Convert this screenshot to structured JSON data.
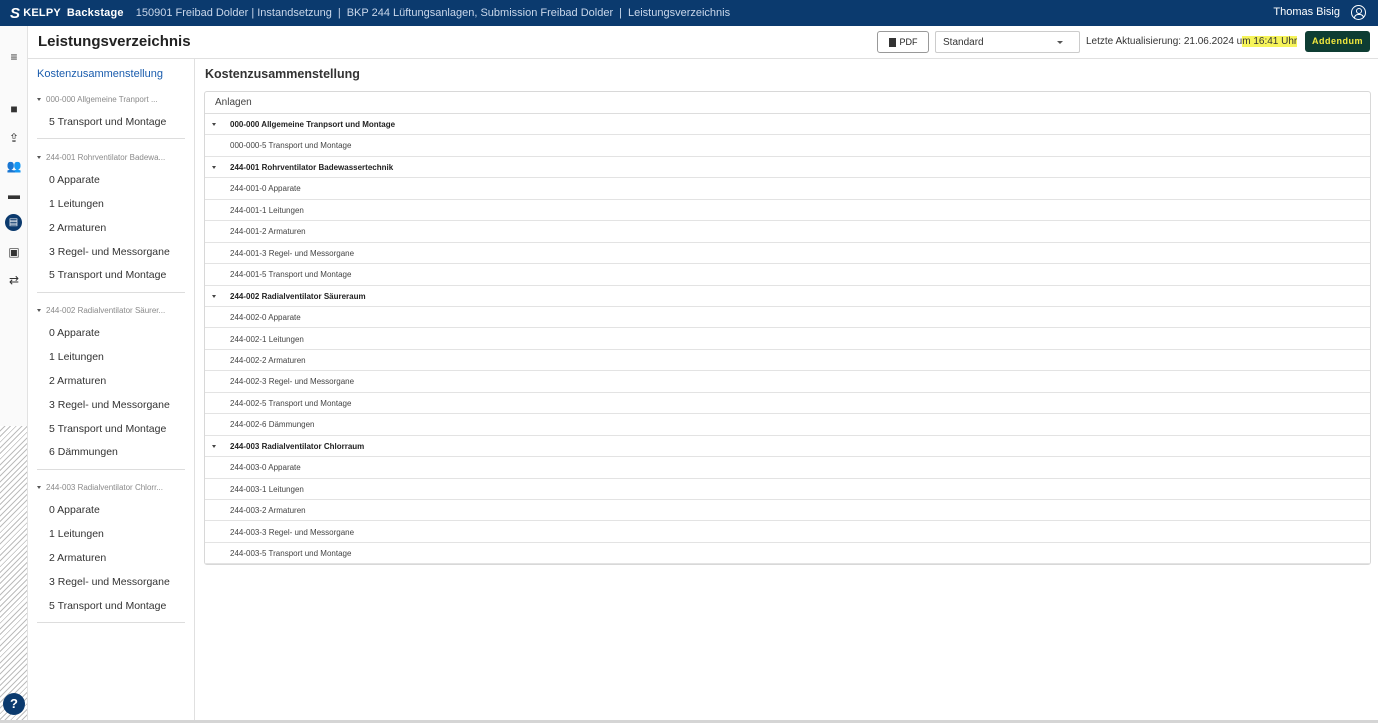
{
  "app": {
    "logo_text": "KELPY",
    "product": "Backstage",
    "breadcrumbs": [
      "150901 Freibad Dolder | Instandsetzung",
      "BKP 244 Lüftungsanlagen, Submission Freibad Dolder",
      "Leistungsverzeichnis"
    ],
    "user_name": "Thomas Bisig"
  },
  "header": {
    "title": "Leistungsverzeichnis",
    "pdf_label": "PDF",
    "view_select": "Standard",
    "last_update_prefix": "Letzte Aktualisierung: 21.06.2024 u",
    "last_update_highlight": "m 16:41 Uhr",
    "addendum_label": "Addendum"
  },
  "tree": {
    "top": "Kostenzusammenstellung",
    "groups": [
      {
        "head": "000-000 Allgemeine Tranport ...",
        "items": [
          "5 Transport und Montage"
        ]
      },
      {
        "head": "244-001 Rohrventilator Badewa...",
        "items": [
          "0 Apparate",
          "1 Leitungen",
          "2 Armaturen",
          "3 Regel- und Messorgane",
          "5 Transport und Montage"
        ]
      },
      {
        "head": "244-002 Radialventilator Säurer...",
        "items": [
          "0 Apparate",
          "1 Leitungen",
          "2 Armaturen",
          "3 Regel- und Messorgane",
          "5 Transport und Montage",
          "6 Dämmungen"
        ]
      },
      {
        "head": "244-003 Radialventilator Chlorr...",
        "items": [
          "0 Apparate",
          "1 Leitungen",
          "2 Armaturen",
          "3 Regel- und Messorgane",
          "5 Transport und Montage"
        ]
      }
    ]
  },
  "main": {
    "title": "Kostenzusammenstellung",
    "table_header": "Anlagen",
    "rows": [
      {
        "type": "group",
        "text": "000-000 Allgemeine Tranpsort und Montage"
      },
      {
        "type": "item",
        "text": "000-000-5 Transport und Montage"
      },
      {
        "type": "group",
        "text": "244-001 Rohrventilator Badewassertechnik"
      },
      {
        "type": "item",
        "text": "244-001-0 Apparate"
      },
      {
        "type": "item",
        "text": "244-001-1 Leitungen"
      },
      {
        "type": "item",
        "text": "244-001-2 Armaturen"
      },
      {
        "type": "item",
        "text": "244-001-3 Regel- und Messorgane"
      },
      {
        "type": "item",
        "text": "244-001-5 Transport und Montage"
      },
      {
        "type": "group",
        "text": "244-002 Radialventilator Säureraum"
      },
      {
        "type": "item",
        "text": "244-002-0 Apparate"
      },
      {
        "type": "item",
        "text": "244-002-1 Leitungen"
      },
      {
        "type": "item",
        "text": "244-002-2 Armaturen"
      },
      {
        "type": "item",
        "text": "244-002-3 Regel- und Messorgane"
      },
      {
        "type": "item",
        "text": "244-002-5 Transport und Montage"
      },
      {
        "type": "item",
        "text": "244-002-6 Dämmungen"
      },
      {
        "type": "group",
        "text": "244-003 Radialventilator Chlorraum"
      },
      {
        "type": "item",
        "text": "244-003-0 Apparate"
      },
      {
        "type": "item",
        "text": "244-003-1 Leitungen"
      },
      {
        "type": "item",
        "text": "244-003-2 Armaturen"
      },
      {
        "type": "item",
        "text": "244-003-3 Regel- und Messorgane"
      },
      {
        "type": "item",
        "text": "244-003-5 Transport und Montage"
      }
    ]
  },
  "rail_icons": [
    "menu-icon",
    "briefcase-icon",
    "upload-icon",
    "people-icon",
    "truck-icon",
    "document-icon",
    "calendar-icon",
    "transfer-icon"
  ],
  "help_label": "?"
}
